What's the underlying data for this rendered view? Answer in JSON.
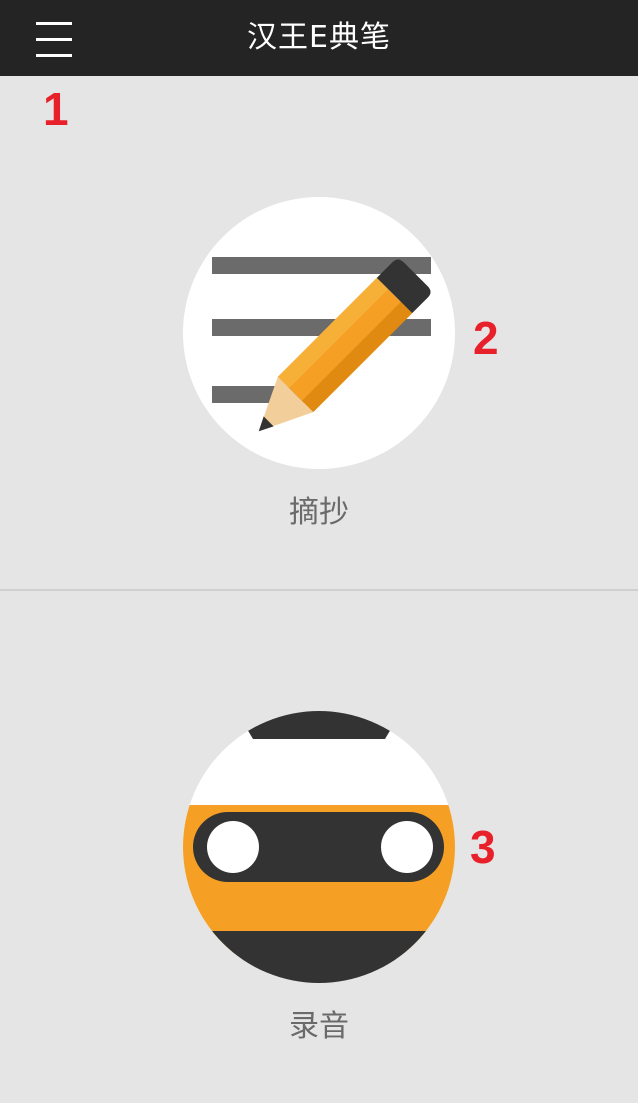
{
  "header": {
    "title": "汉王E典笔",
    "menu_icon": "hamburger-menu-icon"
  },
  "markers": {
    "one": "1",
    "two": "2",
    "three": "3"
  },
  "features": {
    "excerpt": {
      "label": "摘抄",
      "icon": "pencil-notes-icon"
    },
    "record": {
      "label": "录音",
      "icon": "cassette-tape-icon"
    }
  },
  "colors": {
    "header_bg": "#242424",
    "page_bg": "#e5e5e5",
    "accent_orange": "#f5a024",
    "dark_gray": "#333333",
    "marker_red": "#e8202a"
  }
}
